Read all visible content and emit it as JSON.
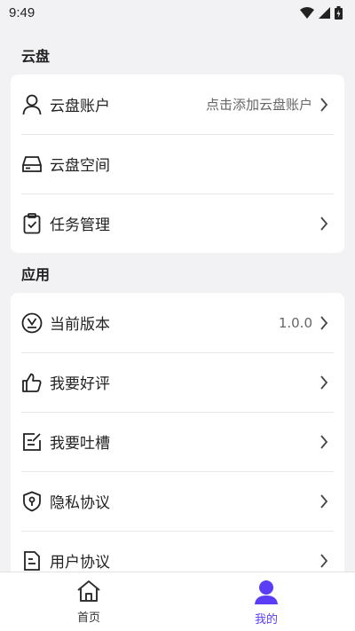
{
  "status_bar": {
    "time": "9:49"
  },
  "cloud_section": {
    "title": "云盘",
    "items": [
      {
        "label": "云盘账户",
        "value": "点击添加云盘账户",
        "icon": "user-icon",
        "has_chevron": true
      },
      {
        "label": "云盘空间",
        "value": "",
        "icon": "drive-icon",
        "has_chevron": false
      },
      {
        "label": "任务管理",
        "value": "",
        "icon": "clipboard-check-icon",
        "has_chevron": true
      }
    ]
  },
  "app_section": {
    "title": "应用",
    "items": [
      {
        "label": "当前版本",
        "value": "1.0.0",
        "icon": "version-icon",
        "has_chevron": true
      },
      {
        "label": "我要好评",
        "value": "",
        "icon": "thumbs-up-icon",
        "has_chevron": true
      },
      {
        "label": "我要吐槽",
        "value": "",
        "icon": "feedback-icon",
        "has_chevron": true
      },
      {
        "label": "隐私协议",
        "value": "",
        "icon": "shield-lock-icon",
        "has_chevron": true
      },
      {
        "label": "用户协议",
        "value": "",
        "icon": "document-icon",
        "has_chevron": true
      }
    ]
  },
  "bottom_nav": {
    "home_label": "首页",
    "mine_label": "我的"
  },
  "colors": {
    "accent": "#5b3df5",
    "background": "#f2f2f4",
    "card": "#ffffff"
  }
}
